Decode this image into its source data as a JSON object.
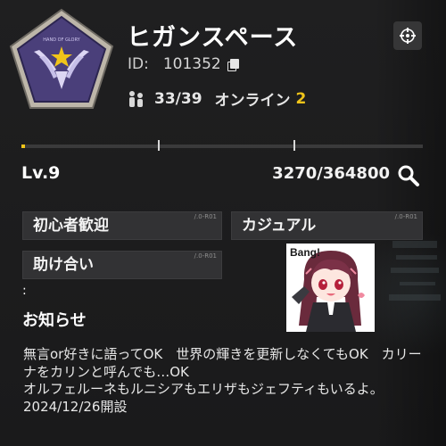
{
  "club": {
    "name": "ヒガンスペース",
    "id_label": "ID:",
    "id_value": "101352",
    "members": "33/39",
    "online_label": "オンライン",
    "online_count": "2",
    "emblem_text": "HAND OF GLORY"
  },
  "level": {
    "label": "Lv.9",
    "exp": "3270/364800",
    "progress_fraction": 0.009
  },
  "tags": [
    {
      "label": "初心者歓迎",
      "code": "/.0-R01"
    },
    {
      "label": "カジュアル",
      "code": "/.0-R01"
    },
    {
      "label": "助け合い",
      "code": "/.0-R01"
    }
  ],
  "sticker": {
    "text": "Bang!"
  },
  "notice": {
    "marker": ":",
    "title": "お知らせ",
    "body": "無言or好きに語ってOK　世界の輝きを更新しなくてもOK　カリーナをカリンと呼んでも…OK\nオルフェルーネもルニシアもエリザもジェフティもいるよ。　　2024/12/26開設"
  },
  "colors": {
    "accent": "#f0c419",
    "emblem_fill": "#4a3f7a",
    "emblem_border": "#c9c2b4",
    "tag_bg": "#323234"
  },
  "icons": [
    "settings-icon",
    "copy-icon",
    "members-icon",
    "search-icon"
  ]
}
